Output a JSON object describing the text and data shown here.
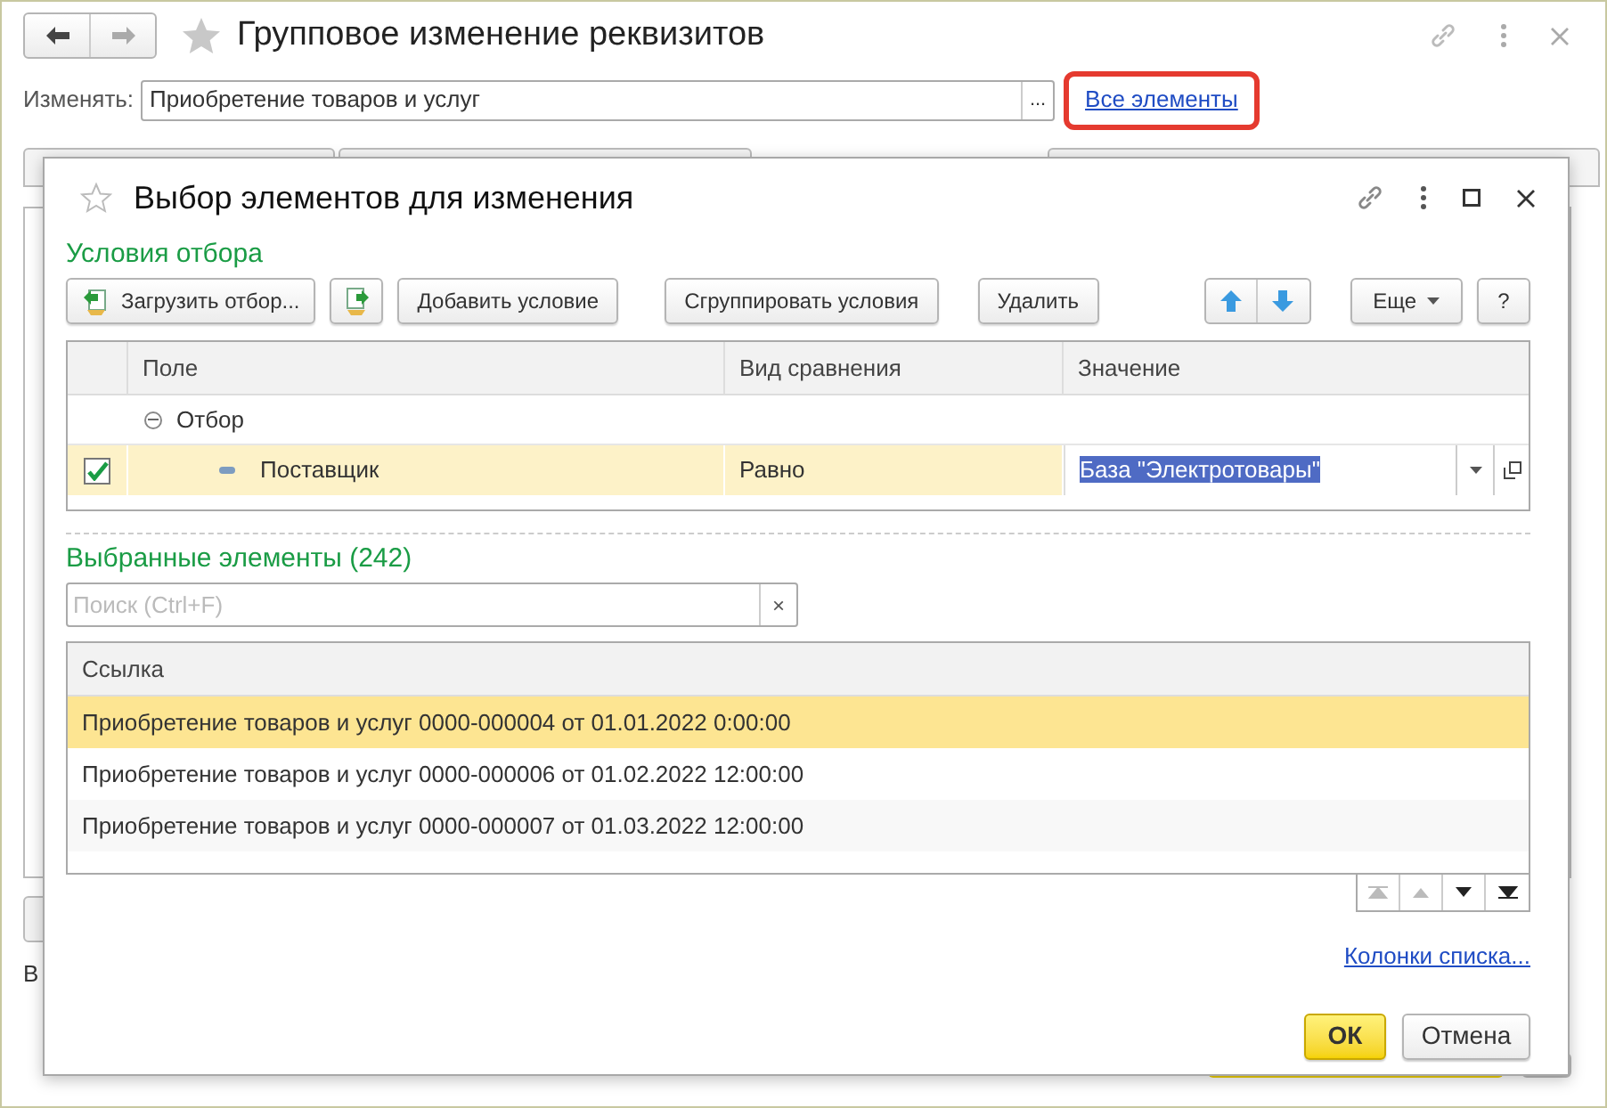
{
  "window": {
    "title": "Групповое изменение реквизитов",
    "field_label": "Изменять:",
    "field_value": "Приобретение товаров и услуг",
    "select_button": "...",
    "link": {
      "label": "Все элементы",
      "highlighted": true
    },
    "background_label": "В"
  },
  "dialog": {
    "title": "Выбор элементов для изменения",
    "filter": {
      "heading": "Условия отбора",
      "toolbar": [
        {
          "kind": "load",
          "label": "Загрузить отбор..."
        },
        {
          "kind": "save"
        },
        {
          "kind": "text",
          "label": "Добавить условие"
        },
        {
          "kind": "text",
          "label": "Сгруппировать условия"
        },
        {
          "kind": "text",
          "label": "Удалить"
        },
        {
          "kind": "arrows"
        },
        {
          "kind": "menu",
          "label": "Еще"
        },
        {
          "kind": "text",
          "label": "?"
        }
      ],
      "columns": [
        "Поле",
        "Вид сравнения",
        "Значение"
      ],
      "group": {
        "label": "Отбор",
        "expanded": true,
        "children": [
          {
            "field": "Поставщик",
            "checked": true,
            "selected": true,
            "comparison": "Равно",
            "value": "База \"Электротовары\""
          }
        ]
      }
    },
    "selected": {
      "heading": "Выбранные элементы (242)",
      "search_placeholder": "Поиск (Ctrl+F)",
      "clear": "×",
      "column": "Ссылка",
      "rows": [
        {
          "text": "Приобретение товаров и услуг 0000-000004 от 01.01.2022 0:00:00",
          "selected": true
        },
        {
          "text": "Приобретение товаров и услуг 0000-000006 от 01.02.2022 12:00:00",
          "selected": false
        },
        {
          "text": "Приобретение товаров и услуг 0000-000007 от 01.03.2022 12:00:00",
          "selected": false
        }
      ],
      "columns_link": "Колонки списка..."
    },
    "buttons": [
      {
        "kind": "primary",
        "label": "ОК"
      },
      {
        "kind": "default",
        "label": "Отмена"
      }
    ]
  }
}
